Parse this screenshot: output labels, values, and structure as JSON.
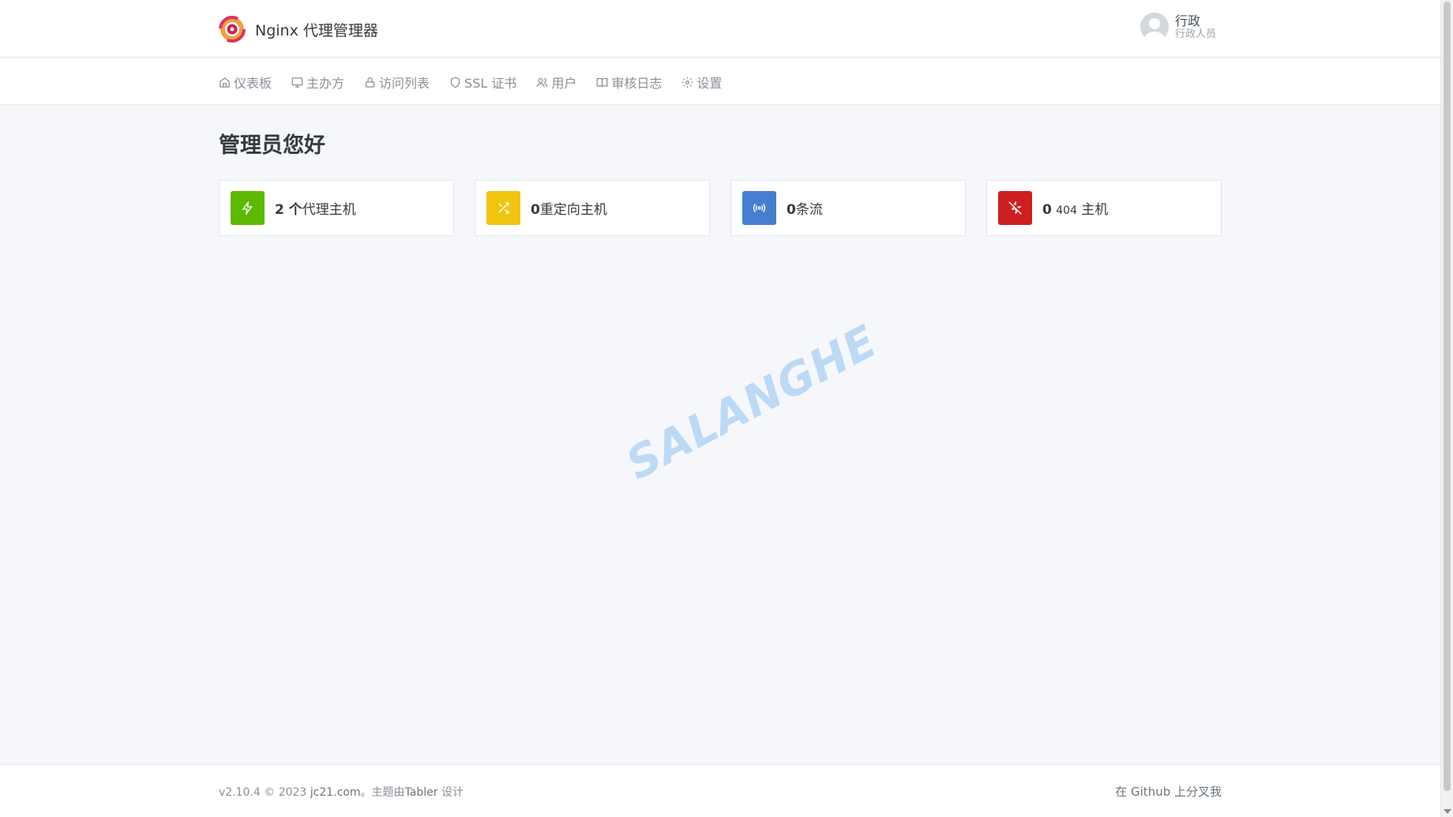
{
  "brand": {
    "title": "Nginx 代理管理器"
  },
  "user": {
    "name": "行政",
    "role": "行政人员"
  },
  "nav": {
    "items": [
      {
        "label": "仪表板",
        "icon": "home-icon"
      },
      {
        "label": "主办方",
        "icon": "monitor-icon"
      },
      {
        "label": "访问列表",
        "icon": "lock-icon"
      },
      {
        "label": "SSL 证书",
        "icon": "shield-icon"
      },
      {
        "label": "用户",
        "icon": "users-icon"
      },
      {
        "label": "审核日志",
        "icon": "book-icon"
      },
      {
        "label": "设置",
        "icon": "gear-icon"
      }
    ]
  },
  "main": {
    "greeting": "管理员您好",
    "cards": [
      {
        "num": "2 个",
        "label": "代理主机",
        "color": "#5eba00",
        "icon": "zap-icon"
      },
      {
        "num": "0",
        "label": "重定向主机",
        "color": "#f1c40f",
        "icon": "shuffle-icon"
      },
      {
        "num": "0",
        "label": "条流",
        "color": "#467fcf",
        "icon": "radio-icon"
      },
      {
        "num": "0",
        "label_small": "404",
        "label": " 主机",
        "color": "#cd201f",
        "icon": "zap-off-icon"
      }
    ]
  },
  "watermark": {
    "text": "SALANGHE"
  },
  "footer": {
    "version": "v2.10.4 © 2023",
    "link": "jc21.com",
    "suffix": "。主题由",
    "tabler": "Tabler",
    "design": " 设计",
    "github": "在 Github 上分叉我"
  }
}
